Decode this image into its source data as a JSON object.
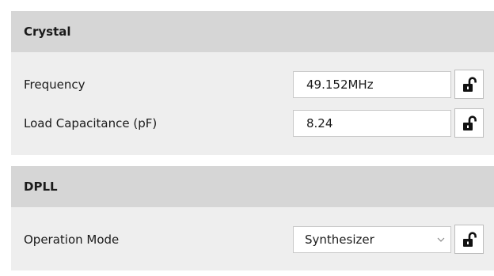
{
  "sections": [
    {
      "title": "Crystal",
      "rows": [
        {
          "label": "Frequency",
          "value": "49.152MHz",
          "lock_icon": "unlocked-padlock-icon"
        },
        {
          "label": "Load Capacitance (pF)",
          "value": "8.24",
          "lock_icon": "unlocked-padlock-icon"
        }
      ]
    },
    {
      "title": "DPLL",
      "rows": [
        {
          "label": "Operation Mode",
          "selected": "Synthesizer",
          "control": "dropdown",
          "lock_icon": "unlocked-padlock-icon"
        }
      ]
    }
  ],
  "colors": {
    "header_bg": "#d6d6d6",
    "body_bg": "#eeeeee",
    "field_border": "#c9c9c9"
  }
}
